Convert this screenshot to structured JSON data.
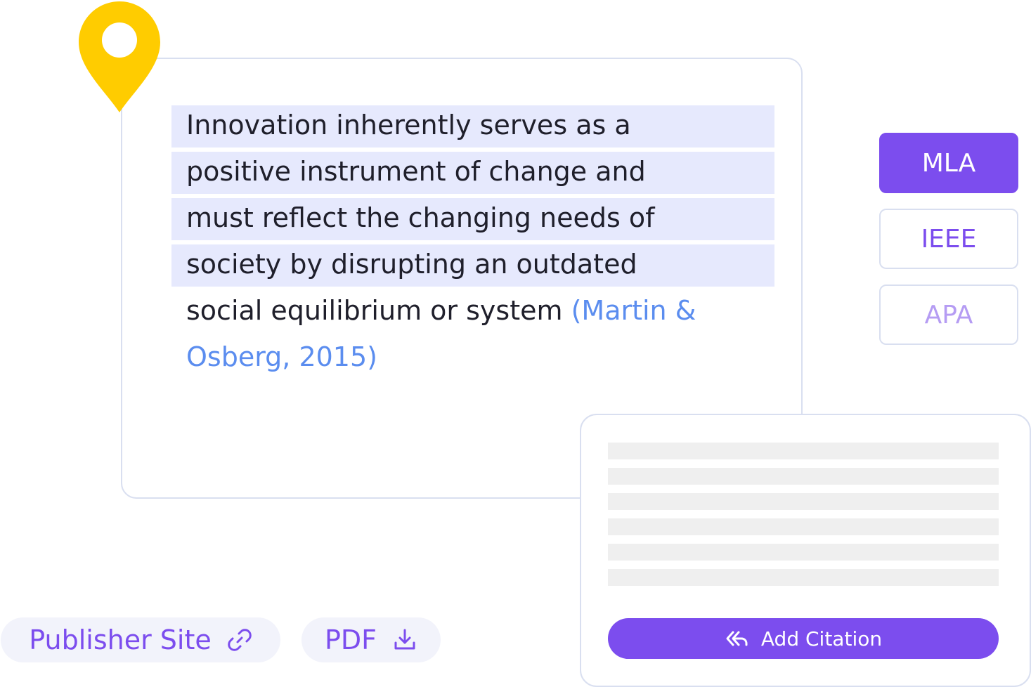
{
  "quote": {
    "lines": [
      "Innovation inherently serves as a",
      "positive instrument of change and",
      "must reflect the changing needs of",
      "society by disrupting an outdated",
      "social equilibrium or system "
    ],
    "citation_part1": "(Martin &",
    "citation_part2": "Osberg, 2015)"
  },
  "styles": {
    "mla": "MLA",
    "ieee": "IEEE",
    "apa": "APA"
  },
  "reference_card": {
    "add_citation_label": "Add Citation"
  },
  "links": {
    "publisher_label": "Publisher Site",
    "pdf_label": "PDF"
  },
  "colors": {
    "accent": "#7c4dee",
    "highlight": "#e6e9fd",
    "citation": "#5b8def",
    "pin": "#ffcc00"
  },
  "icons": {
    "pin": "location-pin-icon",
    "add_citation": "double-back-arrow-icon",
    "publisher": "link-icon",
    "pdf": "download-icon"
  }
}
